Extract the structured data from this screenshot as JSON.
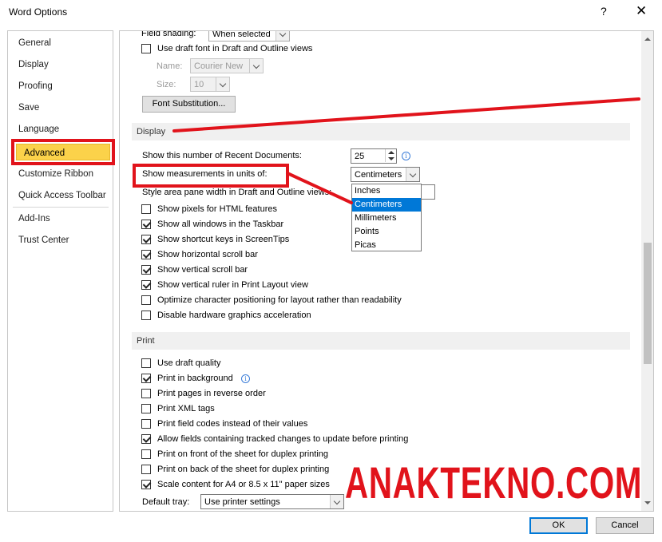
{
  "window": {
    "title": "Word Options",
    "help_glyph": "?",
    "close_glyph": "✕"
  },
  "sidebar": {
    "items": [
      {
        "label": "General"
      },
      {
        "label": "Display"
      },
      {
        "label": "Proofing"
      },
      {
        "label": "Save"
      },
      {
        "label": "Language"
      },
      {
        "label": "Advanced",
        "selected": true
      },
      {
        "label": "Customize Ribbon"
      },
      {
        "label": "Quick Access Toolbar"
      },
      {
        "label": "Add-Ins"
      },
      {
        "label": "Trust Center"
      }
    ]
  },
  "content": {
    "top": {
      "field_shading_label": "Field shading:",
      "field_shading_value": "When selected",
      "draft_font_label": "Use draft font in Draft and Outline views",
      "name_label": "Name:",
      "name_value": "Courier New",
      "size_label": "Size:",
      "size_value": "10",
      "font_substitution_label": "Font Substitution..."
    },
    "display": {
      "heading": "Display",
      "recent_docs_label": "Show this number of Recent Documents:",
      "recent_docs_value": "25",
      "units_label": "Show measurements in units of:",
      "units_value": "Centimeters",
      "style_area_label": "Style area pane width in Draft and Outline views:",
      "units_options": [
        "Inches",
        "Centimeters",
        "Millimeters",
        "Points",
        "Picas"
      ],
      "units_selected": "Centimeters",
      "options": [
        {
          "label": "Show pixels for HTML features",
          "checked": false
        },
        {
          "label": "Show all windows in the Taskbar",
          "checked": true
        },
        {
          "label": "Show shortcut keys in ScreenTips",
          "checked": true
        },
        {
          "label": "Show horizontal scroll bar",
          "checked": true
        },
        {
          "label": "Show vertical scroll bar",
          "checked": true
        },
        {
          "label": "Show vertical ruler in Print Layout view",
          "checked": true
        },
        {
          "label": "Optimize character positioning for layout rather than readability",
          "checked": false
        },
        {
          "label": "Disable hardware graphics acceleration",
          "checked": false
        }
      ]
    },
    "print": {
      "heading": "Print",
      "options": [
        {
          "label": "Use draft quality",
          "checked": false
        },
        {
          "label": "Print in background",
          "checked": true
        },
        {
          "label": "Print pages in reverse order",
          "checked": false
        },
        {
          "label": "Print XML tags",
          "checked": false
        },
        {
          "label": "Print field codes instead of their values",
          "checked": false
        },
        {
          "label": "Allow fields containing tracked changes to update before printing",
          "checked": true
        },
        {
          "label": "Print on front of the sheet for duplex printing",
          "checked": false
        },
        {
          "label": "Print on back of the sheet for duplex printing",
          "checked": false
        },
        {
          "label": "Scale content for A4 or 8.5 x 11\" paper sizes",
          "checked": true
        }
      ],
      "default_tray_label": "Default tray:",
      "default_tray_value": "Use printer settings"
    }
  },
  "footer": {
    "ok_label": "OK",
    "cancel_label": "Cancel"
  },
  "watermark": "ANAKTEKNO.COM",
  "colors": {
    "highlight_red": "#e1131b",
    "selected_yellow": "#fbd24a",
    "accent_blue": "#0078d7"
  }
}
